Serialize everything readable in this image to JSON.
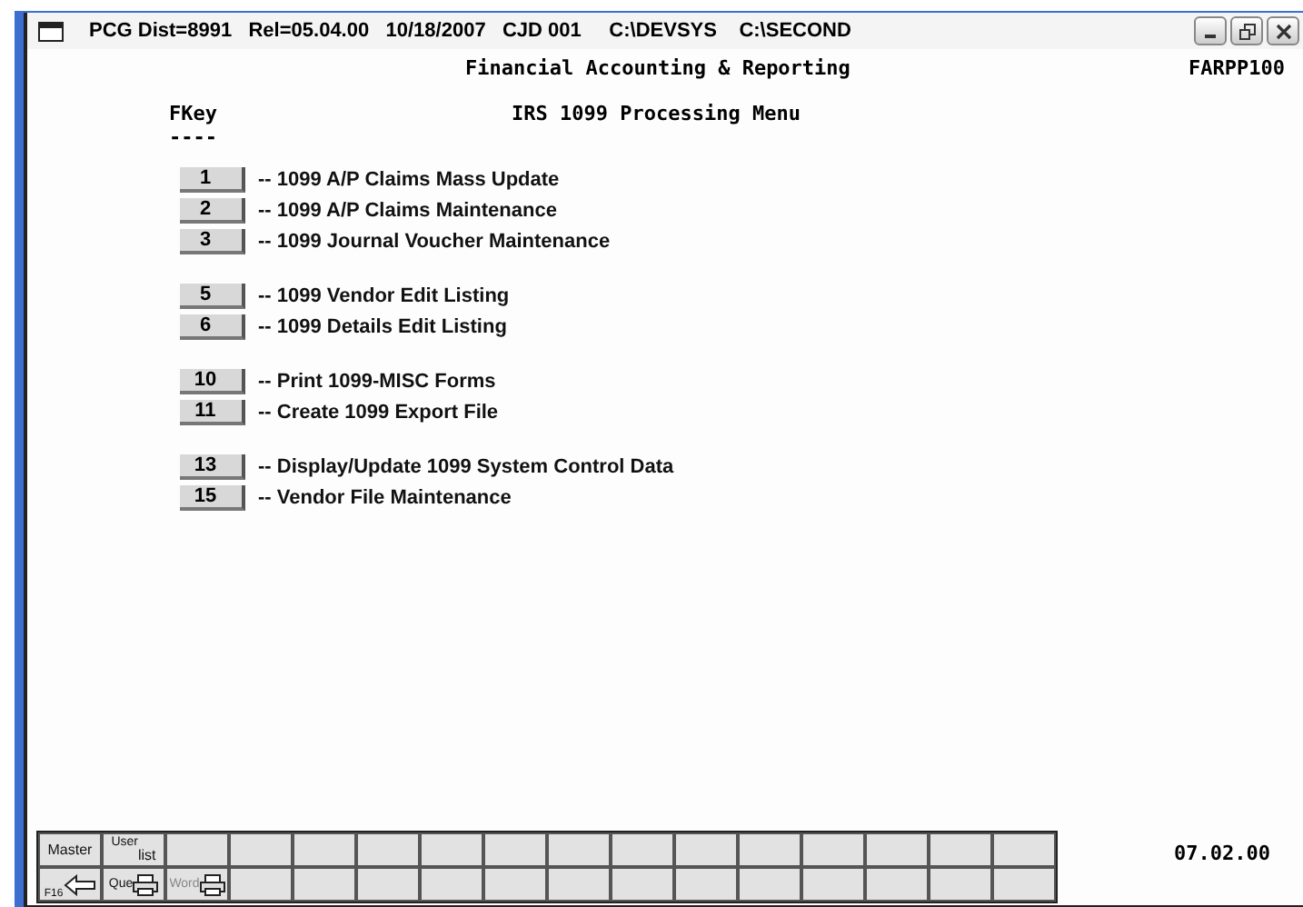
{
  "window": {
    "title": "PCG Dist=8991   Rel=05.04.00   10/18/2007   CJD 001     C:\\DEVSYS    C:\\SECOND"
  },
  "header": {
    "title": "Financial Accounting & Reporting",
    "program": "FARPP100"
  },
  "menu": {
    "column_heading": "FKey",
    "underline": "----",
    "title": "IRS 1099 Processing Menu",
    "groups": [
      {
        "items": [
          {
            "key": "1",
            "label": "-- 1099 A/P Claims Mass Update"
          },
          {
            "key": "2",
            "label": "-- 1099 A/P Claims Maintenance"
          },
          {
            "key": "3",
            "label": "-- 1099 Journal Voucher Maintenance"
          }
        ]
      },
      {
        "items": [
          {
            "key": "5",
            "label": "-- 1099 Vendor Edit Listing"
          },
          {
            "key": "6",
            "label": "-- 1099 Details Edit Listing"
          }
        ]
      },
      {
        "items": [
          {
            "key": "10",
            "label": "-- Print 1099-MISC Forms"
          },
          {
            "key": "11",
            "label": "-- Create 1099 Export File"
          }
        ]
      },
      {
        "items": [
          {
            "key": "13",
            "label": "-- Display/Update 1099 System Control Data"
          },
          {
            "key": "15",
            "label": "-- Vendor File Maintenance"
          }
        ]
      }
    ]
  },
  "toolbar": {
    "rows": [
      [
        {
          "kind": "text",
          "label": "Master",
          "disabled": false
        },
        {
          "kind": "split",
          "top": "User",
          "bottom": "list",
          "disabled": false
        }
      ],
      [
        {
          "kind": "back",
          "label": "F16",
          "disabled": false
        },
        {
          "kind": "print",
          "label": "Que",
          "disabled": false
        },
        {
          "kind": "print",
          "label": "Word",
          "disabled": true
        }
      ]
    ]
  },
  "version": "07.02.00"
}
